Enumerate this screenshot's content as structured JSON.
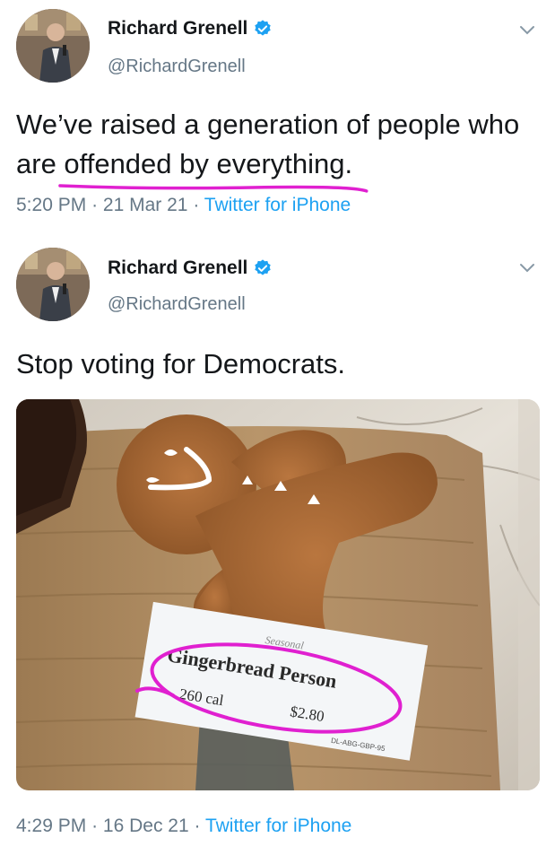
{
  "tweets": [
    {
      "name": "Richard Grenell",
      "handle": "@RichardGrenell",
      "text_before": "We’ve raised a generation of people who are ",
      "text_underlined": "offended by everything.",
      "time": "5:20 PM",
      "separator": "·",
      "date": "21 Mar 21",
      "source": "Twitter for iPhone"
    },
    {
      "name": "Richard Grenell",
      "handle": "@RichardGrenell",
      "text": "Stop voting for Democrats.",
      "time": "4:29 PM",
      "separator": "·",
      "date": "16 Dec 21",
      "source": "Twitter for iPhone",
      "photo": {
        "sign_title": "Gingerbread Person",
        "sign_small_top": "Seasonal",
        "sign_price": "$2.80",
        "sign_cal": "260 cal",
        "sign_code": "DL-ABG-GBP-95"
      }
    }
  ],
  "colors": {
    "text": "#14171a",
    "secondary": "#657786",
    "link": "#1da1f2",
    "verified": "#1da1f2",
    "annotation": "#e020d0"
  },
  "icons": [
    "verified-badge-icon",
    "chevron-down-icon"
  ]
}
